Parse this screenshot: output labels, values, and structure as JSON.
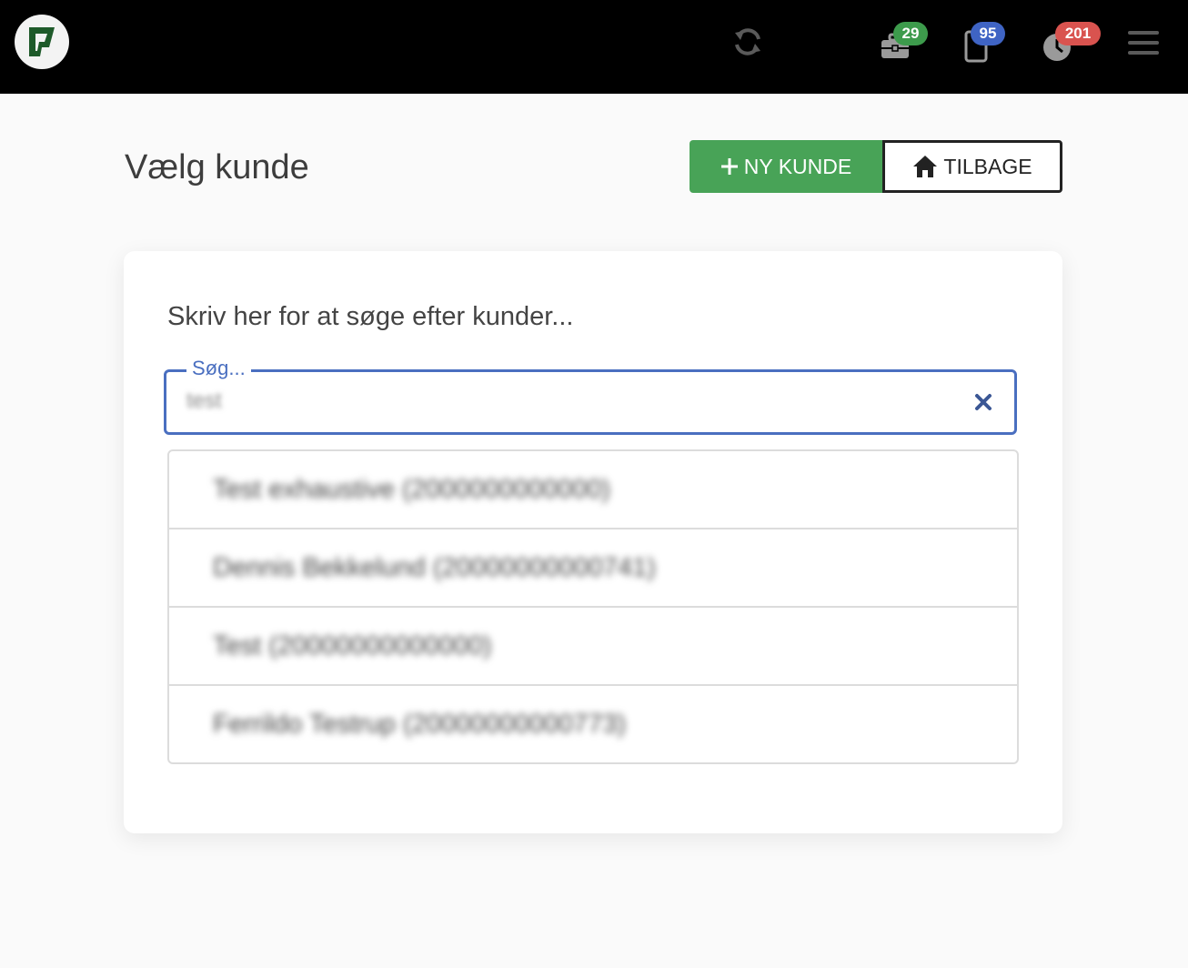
{
  "header": {
    "badges": {
      "briefcase_count": "29",
      "phone_count": "95",
      "clock_count": "201"
    }
  },
  "page": {
    "title": "Vælg kunde",
    "new_customer_label": "NY KUNDE",
    "back_label": "TILBAGE"
  },
  "search": {
    "heading": "Skriv her for at søge efter kunder...",
    "label": "Søg...",
    "value": "test"
  },
  "results": [
    {
      "label": "Test exhaustive (2000000000000)"
    },
    {
      "label": "Dennis Bekkelund (20000000000741)"
    },
    {
      "label": "Test (20000000000000)"
    },
    {
      "label": "Ferrildo Testrup (20000000000773)"
    }
  ],
  "colors": {
    "green": "#48a357",
    "blue": "#3f64c4",
    "red": "#d9534f",
    "field_border": "#4a6fc0"
  },
  "icons": [
    "logo-icon",
    "refresh-icon",
    "briefcase-icon",
    "phone-icon",
    "clock-icon",
    "menu-icon",
    "plus-icon",
    "home-icon",
    "close-icon"
  ]
}
